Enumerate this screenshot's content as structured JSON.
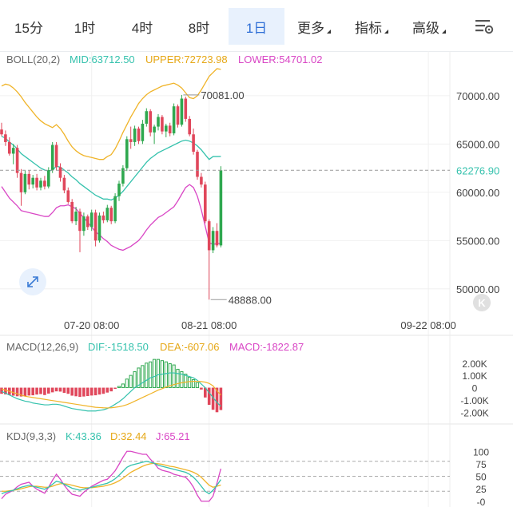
{
  "toolbar": {
    "tabs": [
      {
        "label": "15分",
        "active": false
      },
      {
        "label": "1时",
        "active": false
      },
      {
        "label": "4时",
        "active": false
      },
      {
        "label": "8时",
        "active": false
      },
      {
        "label": "1日",
        "active": true
      },
      {
        "label": "更多",
        "active": false,
        "dropdown": true
      },
      {
        "label": "指标",
        "active": false,
        "dropdown": true
      },
      {
        "label": "高级",
        "active": false,
        "dropdown": true
      }
    ],
    "settings_icon": "chart-settings-icon"
  },
  "colors": {
    "up": "#2fa84f",
    "down": "#e0475b",
    "mid": "#35c2ad",
    "upper": "#f0b429",
    "lower": "#d946c5",
    "dif": "#35c2ad",
    "dea": "#f0b429",
    "k": "#35c2ad",
    "d": "#f0b429",
    "j": "#d946c5",
    "accent": "#2f6fd6"
  },
  "chart_data": [
    {
      "type": "candlestick",
      "name": "BOLL",
      "legend": {
        "title": "BOLL(20,2)",
        "mid": "MID:63712.50",
        "upper": "UPPER:72723.98",
        "lower": "LOWER:54701.02"
      },
      "price_ticks": [
        "70000.00",
        "65000.00",
        "60000.00",
        "55000.00",
        "50000.00"
      ],
      "price_tick_values": [
        70000,
        65000,
        60000,
        55000,
        50000
      ],
      "ylim": [
        48000,
        72800
      ],
      "last_price": 62276.9,
      "last_price_label": "62276.90",
      "high_label": "70081.00",
      "high_value": 70081,
      "low_label": "48888.00",
      "low_value": 48888,
      "date_labels": [
        "07-20 08:00",
        "08-21 08:00",
        "09-22 08:00"
      ],
      "ohlc": [
        [
          66500,
          67200,
          65800,
          66000
        ],
        [
          66000,
          66400,
          64800,
          65200
        ],
        [
          65200,
          65700,
          63800,
          64000
        ],
        [
          64000,
          65000,
          62900,
          64600
        ],
        [
          64600,
          64900,
          61500,
          62000
        ],
        [
          62000,
          62400,
          58600,
          60000
        ],
        [
          60000,
          62300,
          59800,
          61900
        ],
        [
          61900,
          62300,
          60300,
          60800
        ],
        [
          60800,
          61800,
          60400,
          61500
        ],
        [
          61500,
          61900,
          60200,
          60500
        ],
        [
          60500,
          61500,
          60200,
          61200
        ],
        [
          61200,
          61700,
          60300,
          60600
        ],
        [
          60600,
          62600,
          60400,
          62300
        ],
        [
          62300,
          65200,
          62000,
          64900
        ],
        [
          64900,
          65200,
          62300,
          62600
        ],
        [
          62600,
          63000,
          61100,
          61500
        ],
        [
          61500,
          61800,
          59900,
          60200
        ],
        [
          60200,
          60500,
          58800,
          59000
        ],
        [
          59000,
          59300,
          56800,
          57000
        ],
        [
          57000,
          58500,
          56600,
          58000
        ],
        [
          58000,
          58300,
          53800,
          56000
        ],
        [
          56000,
          57900,
          55500,
          57500
        ],
        [
          57500,
          57700,
          56100,
          56400
        ],
        [
          56400,
          58200,
          56000,
          57900
        ],
        [
          57900,
          58200,
          54400,
          55000
        ],
        [
          55000,
          57900,
          54800,
          57600
        ],
        [
          57600,
          58000,
          56800,
          57100
        ],
        [
          57100,
          58700,
          56900,
          58400
        ],
        [
          58400,
          58600,
          56700,
          57000
        ],
        [
          57000,
          59900,
          56800,
          59600
        ],
        [
          59600,
          61200,
          59100,
          60900
        ],
        [
          60900,
          62800,
          60600,
          62500
        ],
        [
          62500,
          65800,
          62200,
          65500
        ],
        [
          65500,
          66800,
          64500,
          65200
        ],
        [
          65200,
          66900,
          64800,
          66600
        ],
        [
          66600,
          66800,
          65000,
          65300
        ],
        [
          65300,
          67500,
          65000,
          67100
        ],
        [
          67100,
          68700,
          66800,
          68400
        ],
        [
          68400,
          68600,
          65800,
          66200
        ],
        [
          66200,
          67000,
          65000,
          66800
        ],
        [
          66800,
          68100,
          66400,
          67800
        ],
        [
          67800,
          68000,
          66000,
          66300
        ],
        [
          66300,
          67100,
          65700,
          66900
        ],
        [
          66900,
          67200,
          65800,
          66100
        ],
        [
          66100,
          69200,
          65900,
          68900
        ],
        [
          68900,
          69100,
          66700,
          67000
        ],
        [
          67000,
          70081,
          66800,
          69700
        ],
        [
          69700,
          69900,
          67300,
          67600
        ],
        [
          67600,
          67900,
          65800,
          66000
        ],
        [
          66000,
          66600,
          63900,
          64200
        ],
        [
          64200,
          64400,
          61300,
          61600
        ],
        [
          61600,
          62000,
          60500,
          60800
        ],
        [
          60800,
          61100,
          56800,
          57000
        ],
        [
          57000,
          57200,
          48888,
          54000
        ],
        [
          54000,
          56400,
          53700,
          56000
        ],
        [
          56000,
          56800,
          54300,
          54500
        ],
        [
          54500,
          62700,
          54300,
          62276.9
        ]
      ],
      "boll_mid": [
        65800,
        65600,
        65200,
        64900,
        64500,
        64000,
        63700,
        63400,
        63100,
        62800,
        62500,
        62300,
        62200,
        62300,
        62700,
        62600,
        62300,
        62000,
        61600,
        61300,
        60900,
        60600,
        60300,
        60000,
        59700,
        59500,
        59300,
        59300,
        59200,
        59400,
        59700,
        60100,
        60600,
        61100,
        61600,
        62100,
        62600,
        63100,
        63500,
        63800,
        64100,
        64300,
        64500,
        64700,
        64900,
        65100,
        65300,
        65400,
        65300,
        65100,
        64800,
        64400,
        63900,
        63400,
        63700,
        63700,
        63712.5
      ],
      "boll_upper": [
        71000,
        71200,
        71100,
        70800,
        70400,
        69900,
        69300,
        68800,
        68300,
        67800,
        67400,
        67100,
        66900,
        66700,
        67000,
        66600,
        66000,
        65300,
        64700,
        64300,
        64000,
        63800,
        63700,
        63600,
        63500,
        63400,
        63400,
        63700,
        63900,
        64500,
        65300,
        66200,
        67000,
        67800,
        68500,
        69200,
        69700,
        70100,
        70400,
        70600,
        70800,
        71000,
        71100,
        71200,
        71300,
        71100,
        70800,
        70300,
        69800,
        69700,
        70000,
        70600,
        71300,
        72000,
        72400,
        72800,
        72723.98
      ],
      "boll_lower": [
        60600,
        60000,
        59400,
        59000,
        58600,
        58100,
        58000,
        57900,
        57800,
        57700,
        57600,
        57500,
        57500,
        57900,
        58400,
        58600,
        58600,
        58700,
        58500,
        58300,
        57800,
        57400,
        56900,
        56400,
        55900,
        55600,
        55200,
        54900,
        54500,
        54300,
        54100,
        54000,
        54200,
        54400,
        54700,
        55000,
        55500,
        56100,
        56600,
        57000,
        57400,
        57600,
        57900,
        58200,
        58500,
        59100,
        59800,
        60500,
        60800,
        60500,
        59600,
        58200,
        56500,
        54800,
        54600,
        54700,
        54701.02
      ]
    },
    {
      "type": "macd",
      "name": "MACD",
      "legend": {
        "title": "MACD(12,26,9)",
        "dif": "DIF:-1518.50",
        "dea": "DEA:-607.06",
        "macd": "MACD:-1822.87"
      },
      "ticks": [
        "2.00K",
        "1.00K",
        "0",
        "-1.00K",
        "-2.00K"
      ],
      "tick_values": [
        2000,
        1000,
        0,
        -1000,
        -2000
      ],
      "ylim": [
        -2500,
        2700
      ],
      "histogram": [
        -500,
        -550,
        -600,
        -650,
        -700,
        -720,
        -680,
        -640,
        -620,
        -560,
        -520,
        -600,
        -480,
        -380,
        -300,
        -320,
        -420,
        -500,
        -650,
        -700,
        -750,
        -720,
        -680,
        -640,
        -620,
        -560,
        -500,
        -400,
        -300,
        -100,
        100,
        300,
        700,
        1000,
        1300,
        1600,
        1800,
        2000,
        2100,
        2300,
        2300,
        2200,
        2100,
        1950,
        1850,
        1500,
        1300,
        1100,
        850,
        650,
        400,
        -150,
        -800,
        -1400,
        -1800,
        -2000,
        -1822.87
      ],
      "dif": [
        -300,
        -450,
        -600,
        -750,
        -900,
        -1000,
        -1100,
        -1150,
        -1250,
        -1300,
        -1350,
        -1400,
        -1400,
        -1350,
        -1350,
        -1400,
        -1500,
        -1600,
        -1700,
        -1750,
        -1800,
        -1850,
        -1900,
        -1900,
        -1900,
        -1850,
        -1800,
        -1700,
        -1550,
        -1350,
        -1150,
        -900,
        -600,
        -300,
        0,
        200,
        400,
        600,
        800,
        900,
        1050,
        1100,
        1150,
        1200,
        1200,
        1150,
        1100,
        1000,
        900,
        800,
        600,
        300,
        0,
        -400,
        -800,
        -1200,
        -1518.5
      ],
      "dea": [
        -100,
        -200,
        -300,
        -400,
        -500,
        -600,
        -700,
        -750,
        -800,
        -850,
        -900,
        -950,
        -1000,
        -1050,
        -1100,
        -1150,
        -1200,
        -1250,
        -1300,
        -1350,
        -1400,
        -1450,
        -1500,
        -1550,
        -1600,
        -1620,
        -1640,
        -1650,
        -1640,
        -1600,
        -1550,
        -1480,
        -1380,
        -1250,
        -1100,
        -950,
        -800,
        -650,
        -500,
        -350,
        -200,
        -80,
        50,
        150,
        250,
        330,
        400,
        450,
        500,
        520,
        520,
        500,
        450,
        350,
        150,
        -250,
        -607.06
      ]
    },
    {
      "type": "kdj",
      "name": "KDJ",
      "legend": {
        "title": "KDJ(9,3,3)",
        "k": "K:43.36",
        "d": "D:32.44",
        "j": "J:65.21"
      },
      "ticks": [
        "100",
        "75",
        "50",
        "25",
        "-0"
      ],
      "tick_values": [
        100,
        75,
        50,
        25,
        0
      ],
      "ylim": [
        -2,
        110
      ],
      "k": [
        15,
        18,
        20,
        22,
        25,
        28,
        30,
        32,
        30,
        28,
        26,
        24,
        28,
        34,
        40,
        38,
        34,
        30,
        26,
        24,
        22,
        24,
        26,
        28,
        30,
        32,
        34,
        36,
        40,
        45,
        52,
        60,
        68,
        72,
        74,
        76,
        78,
        80,
        78,
        76,
        72,
        70,
        68,
        66,
        64,
        62,
        60,
        58,
        54,
        48,
        40,
        30,
        20,
        15,
        22,
        32,
        43.36
      ],
      "d": [
        20,
        20,
        21,
        22,
        23,
        25,
        27,
        29,
        30,
        30,
        29,
        28,
        28,
        30,
        33,
        35,
        35,
        34,
        32,
        30,
        28,
        27,
        27,
        27,
        28,
        29,
        30,
        32,
        34,
        37,
        41,
        46,
        52,
        58,
        62,
        66,
        70,
        73,
        75,
        76,
        75,
        74,
        72,
        70,
        69,
        67,
        65,
        63,
        61,
        58,
        54,
        48,
        40,
        32,
        28,
        30,
        32.44
      ],
      "j": [
        5,
        14,
        18,
        22,
        29,
        34,
        36,
        38,
        30,
        24,
        20,
        16,
        28,
        42,
        54,
        44,
        32,
        22,
        14,
        12,
        10,
        18,
        24,
        30,
        34,
        38,
        42,
        44,
        52,
        61,
        74,
        88,
        100,
        100,
        98,
        96,
        94,
        94,
        84,
        76,
        66,
        62,
        60,
        58,
        54,
        52,
        50,
        48,
        40,
        28,
        12,
        0,
        0,
        0,
        10,
        36,
        65.21
      ]
    }
  ]
}
